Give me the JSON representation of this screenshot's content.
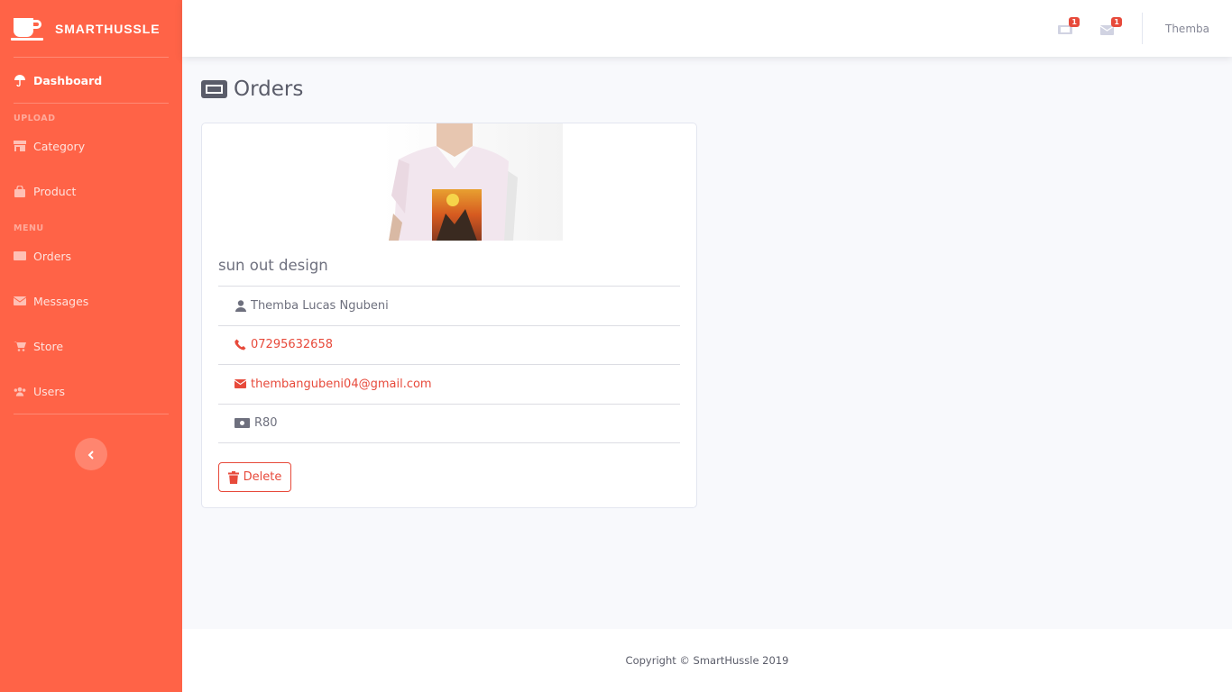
{
  "brand": {
    "name": "SMARTHUSSLE",
    "icon": "coffee-cup-icon"
  },
  "sidebar": {
    "dashboard": {
      "label": "Dashboard",
      "icon": "umbrella-icon"
    },
    "headings": {
      "upload": "UPLOAD",
      "menu": "MENU"
    },
    "items": [
      {
        "label": "Category",
        "icon": "store-icon"
      },
      {
        "label": "Product",
        "icon": "shopping-bag-icon"
      },
      {
        "label": "Orders",
        "icon": "ticket-icon"
      },
      {
        "label": "Messages",
        "icon": "envelope-icon"
      },
      {
        "label": "Store",
        "icon": "cart-icon"
      },
      {
        "label": "Users",
        "icon": "users-icon"
      }
    ],
    "toggle_icon": "chevron-left-icon"
  },
  "topbar": {
    "orders_badge": "1",
    "messages_badge": "1",
    "user_name": "Themba"
  },
  "page": {
    "title": "Orders",
    "title_icon": "ticket-icon"
  },
  "order": {
    "product_name": "sun out design",
    "customer_name": "Themba Lucas Ngubeni",
    "phone": "07295632658",
    "email": "thembangubeni04@gmail.com",
    "price": "R80",
    "delete_label": "Delete"
  },
  "footer": {
    "copyright": "Copyright © SmartHussle 2019"
  },
  "colors": {
    "sidebar": "#ff6347",
    "danger": "#e74a3b",
    "background": "#f8f9fc"
  }
}
